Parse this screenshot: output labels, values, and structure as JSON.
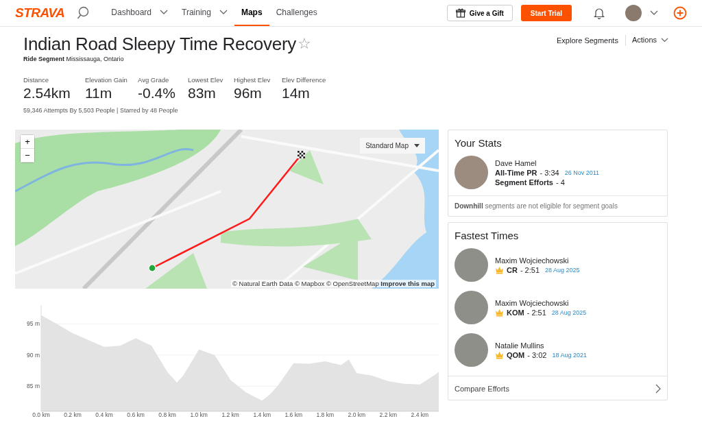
{
  "header": {
    "logo": "STRAVA",
    "nav": [
      {
        "label": "Dashboard",
        "has_menu": true,
        "selected": false
      },
      {
        "label": "Training",
        "has_menu": true,
        "selected": false
      },
      {
        "label": "Maps",
        "has_menu": false,
        "selected": true
      },
      {
        "label": "Challenges",
        "has_menu": false,
        "selected": false
      }
    ],
    "gift_button": "Give a Gift",
    "trial_button": "Start Trial"
  },
  "segment": {
    "title": "Indian Road Sleepy Time Recovery",
    "star": "☆",
    "type": "Ride Segment",
    "location": "Mississauga, Ontario",
    "stats": [
      {
        "label": "Distance",
        "value": "2.54km"
      },
      {
        "label": "Elevation Gain",
        "value": "11m"
      },
      {
        "label": "Avg Grade",
        "value": "-0.4%"
      },
      {
        "label": "Lowest Elev",
        "value": "83m"
      },
      {
        "label": "Highest Elev",
        "value": "96m"
      },
      {
        "label": "Elev Difference",
        "value": "14m"
      }
    ],
    "attempts": "59,346 Attempts By 5,503 People | Starred by 48 People"
  },
  "actions": {
    "explore": "Explore Segments",
    "menu": "Actions"
  },
  "map": {
    "zoom_in": "+",
    "zoom_out": "−",
    "style_menu": "Standard Map",
    "attribution": "© Natural Earth Data © Mapbox © OpenStreetMap",
    "improve_link": "Improve this map"
  },
  "elevation": {
    "chart_data": {
      "type": "area",
      "x": [
        0,
        0.1,
        0.2,
        0.3,
        0.4,
        0.5,
        0.6,
        0.7,
        0.8,
        0.86,
        0.9,
        1.0,
        1.1,
        1.2,
        1.3,
        1.4,
        1.45,
        1.5,
        1.6,
        1.7,
        1.8,
        1.9,
        1.95,
        2.0,
        2.1,
        2.2,
        2.3,
        2.4,
        2.5,
        2.52
      ],
      "grid": true,
      "series": [
        {
          "color": "#e3e3e3",
          "values": [
            96.4,
            95.0,
            93.5,
            92.4,
            91.3,
            91.5,
            92.7,
            91.5,
            87.3,
            85.6,
            86.7,
            90.9,
            90.0,
            86.0,
            84.0,
            82.7,
            83.7,
            85.1,
            88.7,
            88.6,
            89.0,
            88.4,
            89.3,
            87.1,
            86.7,
            85.8,
            85.4,
            85.3,
            86.9,
            87.3
          ]
        }
      ],
      "xlim": [
        0,
        2.52
      ],
      "ylim": [
        81,
        98
      ],
      "yticks": [
        {
          "value": 85,
          "label": "85 m"
        },
        {
          "value": 90,
          "label": "90 m"
        },
        {
          "value": 95,
          "label": "95 m"
        }
      ],
      "xticks": [
        {
          "value": 0,
          "label": "0.0 km"
        },
        {
          "value": 0.2,
          "label": "0.2 km"
        },
        {
          "value": 0.4,
          "label": "0.4 km"
        },
        {
          "value": 0.6,
          "label": "0.6 km"
        },
        {
          "value": 0.8,
          "label": "0.8 km"
        },
        {
          "value": 1.0,
          "label": "1.0 km"
        },
        {
          "value": 1.2,
          "label": "1.2 km"
        },
        {
          "value": 1.4,
          "label": "1.4 km"
        },
        {
          "value": 1.6,
          "label": "1.6 km"
        },
        {
          "value": 1.8,
          "label": "1.8 km"
        },
        {
          "value": 2.0,
          "label": "2.0 km"
        },
        {
          "value": 2.2,
          "label": "2.2 km"
        },
        {
          "value": 2.4,
          "label": "2.4 km"
        }
      ]
    }
  },
  "your_stats": {
    "title": "Your Stats",
    "name": "Dave Hamel",
    "pr_label": "All-Time PR",
    "pr_time": "- 3:34",
    "pr_date": "26 Nov 2011",
    "efforts_label": "Segment Efforts",
    "efforts_count": "- 4",
    "note": "**Downhill** segments are not eligible for segment goals"
  },
  "fastest_times": {
    "title": "Fastest Times",
    "entries": [
      {
        "name": "Maxim Wojciechowski",
        "rank": "CR",
        "time": "- 2:51",
        "date": "28 Aug 2025"
      },
      {
        "name": "Maxim Wojciechowski",
        "rank": "KOM",
        "time": "- 2:51",
        "date": "28 Aug 2025"
      },
      {
        "name": "Natalie Mullins",
        "rank": "QOM",
        "time": "- 3:02",
        "date": "18 Aug 2021"
      }
    ],
    "compare": "Compare Efforts"
  }
}
